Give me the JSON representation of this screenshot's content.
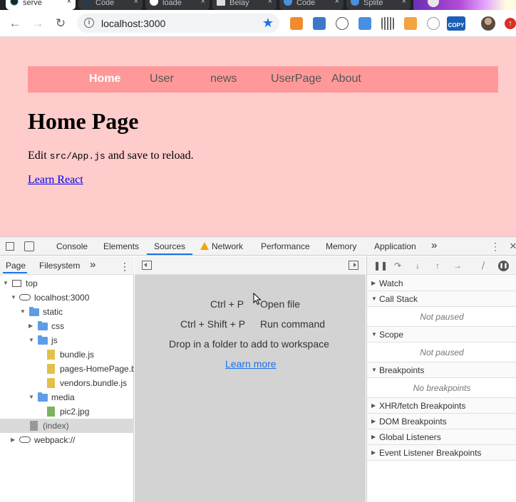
{
  "browser": {
    "tabs": [
      {
        "label": "serve",
        "icon": "react-icon",
        "close": "×"
      },
      {
        "label": "Code",
        "icon": "vscode-icon",
        "close": "×"
      },
      {
        "label": "loade",
        "icon": "github-icon",
        "close": "×"
      },
      {
        "label": "Belay",
        "icon": "document-icon",
        "close": "×"
      },
      {
        "label": "Code",
        "icon": "code-icon",
        "close": "×"
      },
      {
        "label": "Splite",
        "icon": "globe-icon",
        "close": "×"
      }
    ],
    "url": "localhost:3000",
    "badge": "COPY",
    "update": "↑"
  },
  "app": {
    "nav": [
      {
        "label": "Home"
      },
      {
        "label": "User"
      },
      {
        "label": "news"
      },
      {
        "label": "UserPage"
      },
      {
        "label": "About"
      }
    ],
    "heading": "Home Page",
    "edit_pre": "Edit ",
    "edit_code": "src/App.js",
    "edit_post": " and save to reload.",
    "link": "Learn React"
  },
  "devtools": {
    "tabs": [
      "Console",
      "Elements",
      "Sources",
      "Network",
      "Performance",
      "Memory",
      "Application"
    ],
    "more": "»",
    "selected_tab": "Sources",
    "navigator": {
      "tabs": [
        "Page",
        "Filesystem"
      ],
      "more": "»",
      "tree": [
        {
          "label": "top"
        },
        {
          "label": "localhost:3000"
        },
        {
          "label": "static"
        },
        {
          "label": "css"
        },
        {
          "label": "js"
        },
        {
          "label": "bundle.js"
        },
        {
          "label": "pages-HomePage.b"
        },
        {
          "label": "vendors.bundle.js"
        },
        {
          "label": "media"
        },
        {
          "label": "pic2.jpg"
        },
        {
          "label": "(index)"
        },
        {
          "label": "webpack://"
        }
      ]
    },
    "editor": {
      "shortcuts": [
        {
          "keys": "Ctrl + P",
          "action": "Open file"
        },
        {
          "keys": "Ctrl + Shift + P",
          "action": "Run command"
        }
      ],
      "drop_text": "Drop in a folder to add to workspace",
      "learn_more": "Learn more"
    },
    "debugger": {
      "sections": [
        {
          "title": "Watch"
        },
        {
          "title": "Call Stack",
          "body": "Not paused"
        },
        {
          "title": "Scope",
          "body": "Not paused"
        },
        {
          "title": "Breakpoints",
          "body": "No breakpoints"
        },
        {
          "title": "XHR/fetch Breakpoints"
        },
        {
          "title": "DOM Breakpoints"
        },
        {
          "title": "Global Listeners"
        },
        {
          "title": "Event Listener Breakpoints"
        }
      ]
    }
  }
}
